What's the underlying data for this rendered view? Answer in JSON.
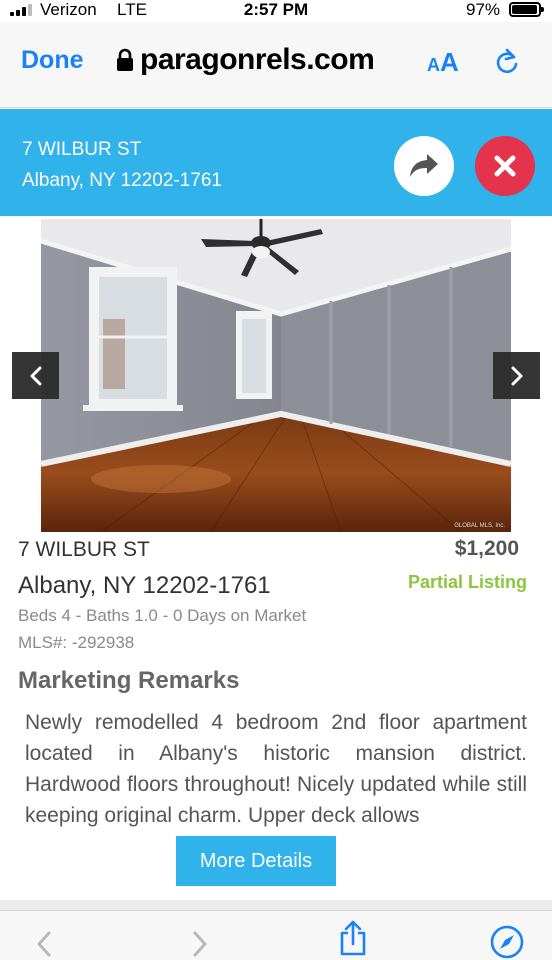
{
  "status_bar": {
    "carrier": "Verizon",
    "network": "LTE",
    "time": "2:57 PM",
    "battery_percent": "97%",
    "battery_level": 0.97
  },
  "browser": {
    "done_label": "Done",
    "url": "paragonrels.com",
    "text_size_label_small": "A",
    "text_size_label_large": "A",
    "icons": [
      "lock-icon",
      "reload-icon",
      "back-icon",
      "forward-icon",
      "share-icon",
      "compass-icon"
    ]
  },
  "header": {
    "street": "7 WILBUR ST",
    "city_line": "Albany, NY 12202-1761",
    "icons": [
      "share-arrow-icon",
      "close-icon"
    ]
  },
  "listing": {
    "street": "7 WILBUR ST",
    "city_line": "Albany, NY 12202-1761",
    "price": "$1,200",
    "status": "Partial Listing",
    "facts": "Beds 4 - Baths 1.0 - 0 Days on Market",
    "mls": "MLS#: -292938",
    "photo_watermark": "GLOBAL MLS, Inc."
  },
  "remarks": {
    "heading": "Marketing Remarks",
    "body": "Newly remodelled 4 bedroom 2nd floor apartment located in Albany's historic mansion district. Hardwood floors throughout! Nicely updated while still keeping original charm. Upper deck allows"
  },
  "actions": {
    "more_details_label": "More Details"
  },
  "colors": {
    "accent_blue": "#2fb3ea",
    "safari_blue": "#1a82f7",
    "close_red": "#e4334c",
    "status_green": "#8cc63f"
  }
}
